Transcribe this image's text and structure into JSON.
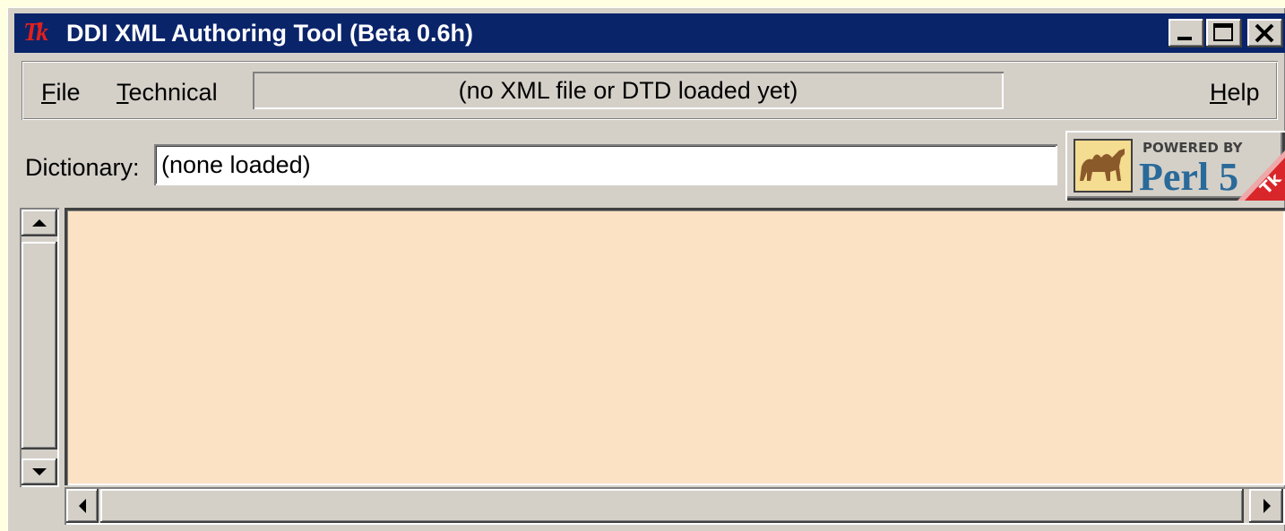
{
  "window": {
    "title": "DDI XML Authoring Tool (Beta 0.6h)",
    "app_icon": "tk-logo-icon",
    "controls": {
      "minimize_icon": "minimize-icon",
      "maximize_icon": "maximize-icon",
      "close_icon": "close-icon"
    }
  },
  "menubar": {
    "items": [
      {
        "accel": "F",
        "rest": "ile"
      },
      {
        "accel": "T",
        "rest": "echnical"
      },
      {
        "accel": "H",
        "rest": "elp"
      }
    ],
    "status": "(no XML file or DTD loaded yet)"
  },
  "dictionary": {
    "label": "Dictionary:",
    "value": "(none loaded)"
  },
  "badge": {
    "top_text": "POWERED BY",
    "main_text": "Perl 5",
    "corner_text": "Tk",
    "icon": "camel-icon"
  },
  "editor": {
    "background_color": "#FCE2C4"
  },
  "colors": {
    "titlebar": "#0A246A",
    "chrome": "#D4D0C8",
    "desktop": "#FFFFE1",
    "tk_red": "#E0201C"
  }
}
